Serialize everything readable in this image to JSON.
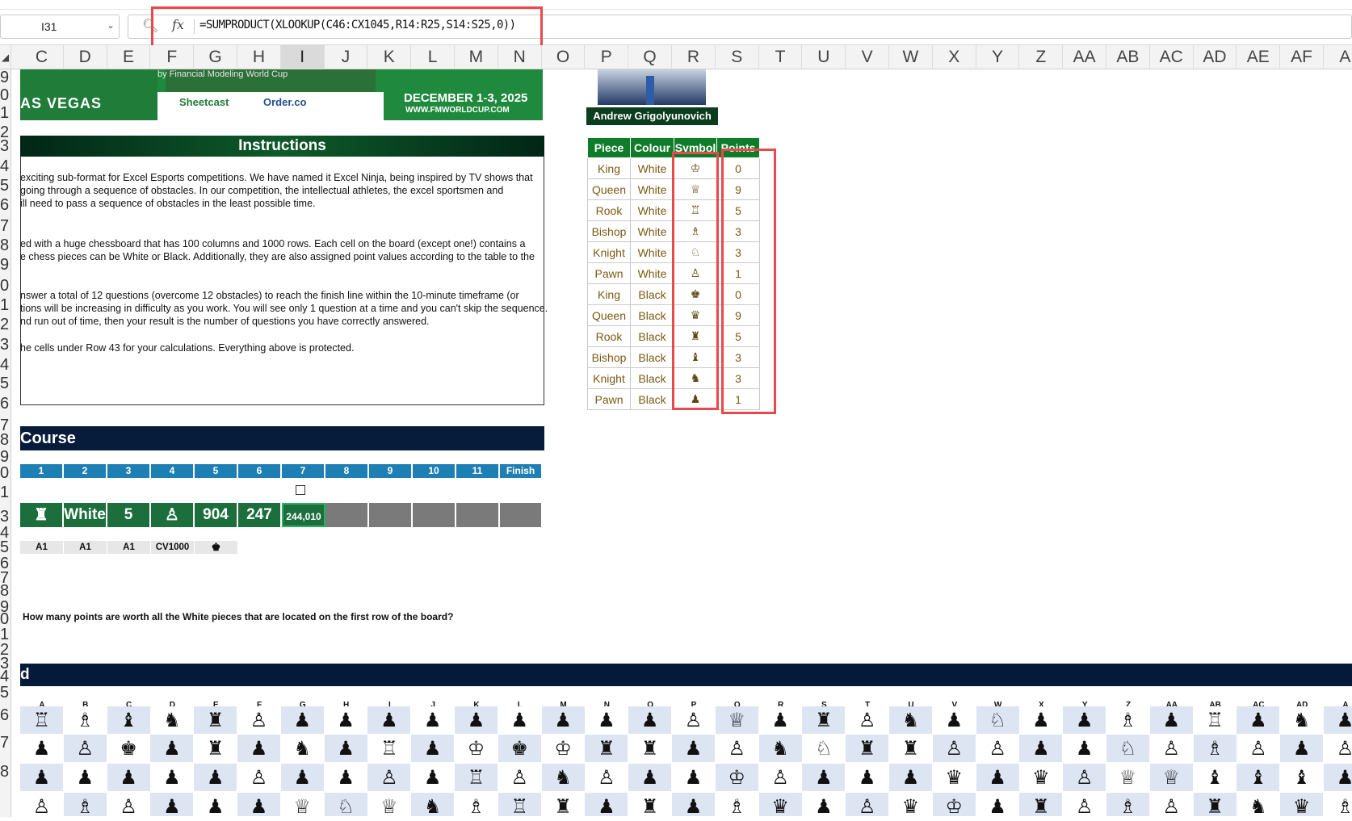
{
  "namebox": {
    "value": "I31"
  },
  "formula": {
    "fx": "fx",
    "text": "=SUMPRODUCT(XLOOKUP(C46:CX1045,R14:R25,S14:S25,0))"
  },
  "columns": [
    "C",
    "D",
    "E",
    "F",
    "G",
    "I",
    "J",
    "K",
    "L",
    "M",
    "N",
    "O",
    "P",
    "Q",
    "R",
    "S",
    "T",
    "U",
    "V",
    "W",
    "X",
    "Y",
    "Z",
    "AA",
    "AB",
    "AC",
    "AD",
    "AE",
    "AF",
    "A"
  ],
  "col_H": "H",
  "rows_visible": [
    "9",
    "0",
    "1",
    "2",
    "3",
    "4",
    "5",
    "6",
    "7",
    "8",
    "9",
    "0",
    "1",
    "2",
    "3",
    "4",
    "5",
    "6",
    "7",
    "8",
    "9",
    "0",
    "1",
    "3",
    "4",
    "5",
    "6",
    "7",
    "8",
    "9",
    "0",
    "1",
    "2",
    "3",
    "4",
    "5",
    "6",
    "7",
    "8"
  ],
  "banner": {
    "by": "by Financial Modeling World Cup",
    "city": "AS VEGAS",
    "sponsor1": "Sheetcast",
    "sponsor2": "Order.co",
    "dates": "DECEMBER 1-3, 2025",
    "url": "WWW.FMWORLDCUP.COM"
  },
  "instructions": {
    "title": "Instructions",
    "lines": [
      "exciting sub-format for Excel Esports competitions. We have named it Excel Ninja, being inspired by TV shows that",
      "going through a sequence of obstacles. In our competition, the intellectual athletes, the excel sportsmen and",
      "ill need to pass a sequence of obstacles in the least possible time.",
      "ed with a huge chessboard that has 100 columns and 1000 rows. Each cell on the board (except one!) contains a",
      "e chess pieces can be White or Black. Additionally, they are also assigned point values according to the table to the",
      "nswer a total of 12 questions (overcome 12 obstacles) to reach the finish line within the 10-minute timeframe (or",
      "tions will be increasing in difficulty as you work. You will see only 1 question at a time and you can't skip the sequence.",
      "nd run out of time, then your result is the number of questions you have correctly answered.",
      "he cells under Row 43 for your calculations. Everything above is protected."
    ]
  },
  "course": {
    "title": "Course",
    "steps": [
      "1",
      "2",
      "3",
      "4",
      "5",
      "6",
      "7",
      "8",
      "9",
      "10",
      "11",
      "Finish"
    ],
    "answers": [
      "♜",
      "White",
      "5",
      "♙",
      "904",
      "247",
      "244,010",
      "",
      "",
      "",
      "",
      ""
    ],
    "sub": [
      "A1",
      "A1",
      "A1",
      "CV1000",
      "♚"
    ],
    "question": "How many points are worth all the White pieces that are located on the first row of the board?"
  },
  "player": {
    "name": "Andrew Grigolyunovich"
  },
  "pieces": {
    "headers": [
      "Piece",
      "Colour",
      "Symbol",
      "Points"
    ],
    "rows": [
      [
        "King",
        "White",
        "♔",
        "0"
      ],
      [
        "Queen",
        "White",
        "♕",
        "9"
      ],
      [
        "Rook",
        "White",
        "♖",
        "5"
      ],
      [
        "Bishop",
        "White",
        "♗",
        "3"
      ],
      [
        "Knight",
        "White",
        "♘",
        "3"
      ],
      [
        "Pawn",
        "White",
        "♙",
        "1"
      ],
      [
        "King",
        "Black",
        "♚",
        "0"
      ],
      [
        "Queen",
        "Black",
        "♛",
        "9"
      ],
      [
        "Rook",
        "Black",
        "♜",
        "5"
      ],
      [
        "Bishop",
        "Black",
        "♝",
        "3"
      ],
      [
        "Knight",
        "Black",
        "♞",
        "3"
      ],
      [
        "Pawn",
        "Black",
        "♟",
        "1"
      ]
    ]
  },
  "board": {
    "title": "d",
    "cols": [
      "A",
      "B",
      "C",
      "D",
      "E",
      "F",
      "G",
      "H",
      "I",
      "J",
      "K",
      "L",
      "M",
      "N",
      "O",
      "P",
      "Q",
      "R",
      "S",
      "T",
      "U",
      "V",
      "W",
      "X",
      "Y",
      "Z",
      "AA",
      "AB",
      "AC",
      "AD",
      "A"
    ],
    "rows": [
      "♖♗♝♞♜♙♟♟♟♟♟♟♟♟♟♙♕♟♜♙♞♟♘♟♟♗♟♖♟♞♟",
      "♟♙♚♟♜♟♞♟♖♟♔♚♔♜♜♟♙♞♘♜♜♙♙♟♟♘♙♗♙♟♙",
      "♟♟♟♟♟♙♟♟♙♟♖♙♞♙♟♟♔♙♟♟♟♛♟♛♙♕♕♝♝♝♟",
      "♙♗♙♟♟♟♕♘♕♞♗♖♜♟♜♟♗♛♟♙♛♔♟♜♙♗♙♜♞♛♗"
    ]
  }
}
